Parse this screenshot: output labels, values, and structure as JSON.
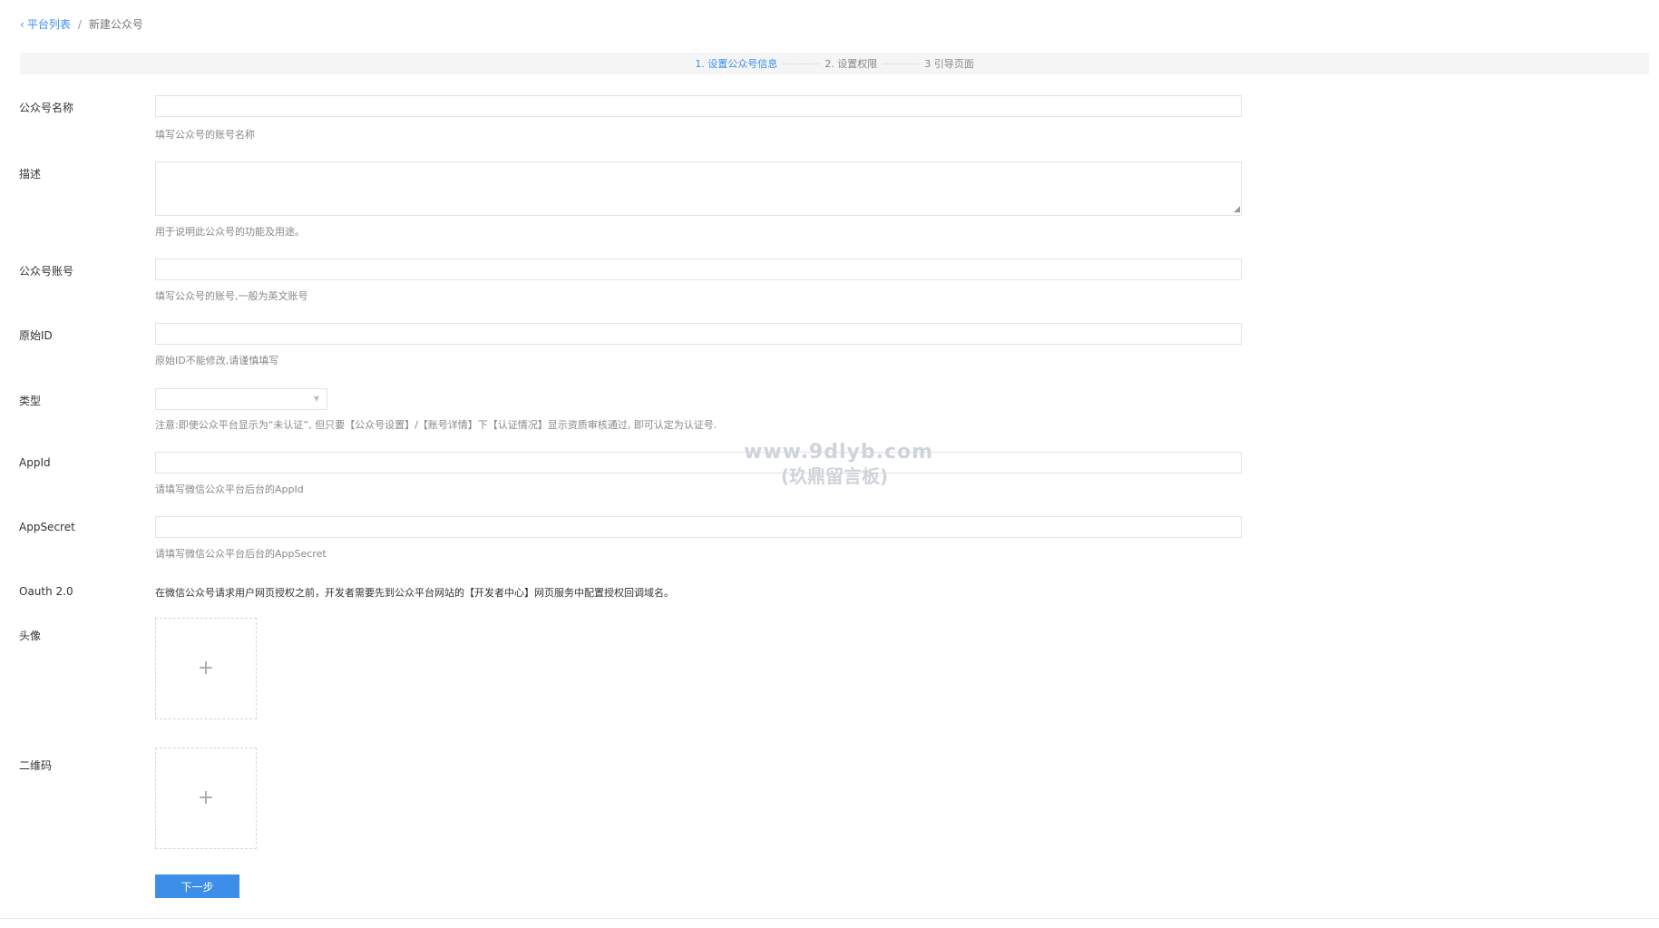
{
  "breadcrumb": {
    "back_icon": "chevron-left-icon",
    "parent": "平台列表",
    "separator": "/",
    "current": "新建公众号"
  },
  "steps": [
    {
      "label": "1. 设置公众号信息",
      "active": true
    },
    {
      "label": "2. 设置权限",
      "active": false
    },
    {
      "label": "3 引导页面",
      "active": false
    }
  ],
  "form": {
    "name": {
      "label": "公众号名称",
      "value": "",
      "help": "填写公众号的账号名称"
    },
    "description": {
      "label": "描述",
      "value": "",
      "help": "用于说明此公众号的功能及用途。"
    },
    "account": {
      "label": "公众号账号",
      "value": "",
      "help": "填写公众号的账号,一般为英文账号"
    },
    "original_id": {
      "label": "原始ID",
      "value": "",
      "help": "原始ID不能修改,请谨慎填写"
    },
    "type": {
      "label": "类型",
      "value": "",
      "help": "注意:即使公众平台显示为“未认证”, 但只要【公众号设置】/【账号详情】下【认证情况】显示资质审核通过, 即可认定为认证号."
    },
    "appid": {
      "label": "AppId",
      "value": "",
      "help": "请填写微信公众平台后台的AppId"
    },
    "appsecret": {
      "label": "AppSecret",
      "value": "",
      "help": "请填写微信公众平台后台的AppSecret"
    },
    "oauth": {
      "label": "Oauth 2.0",
      "text": "在微信公众号请求用户网页授权之前，开发者需要先到公众平台网站的【开发者中心】网页服务中配置授权回调域名。"
    },
    "avatar": {
      "label": "头像",
      "icon": "plus-icon"
    },
    "qrcode": {
      "label": "二维码",
      "icon": "plus-icon"
    }
  },
  "next_button": "下一步",
  "watermark": {
    "line1": "www.9dlyb.com",
    "line2": "(玖鼎留言板)"
  },
  "colors": {
    "accent": "#3c8ee8",
    "border": "#e2e2e2",
    "help": "#888888",
    "steps_bg": "#f5f5f5"
  }
}
